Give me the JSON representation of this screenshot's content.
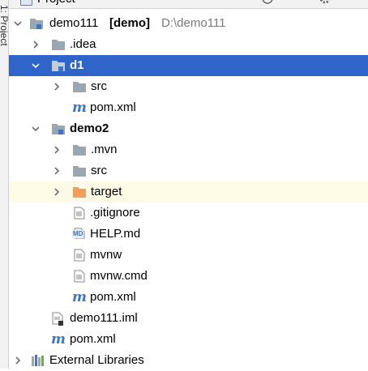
{
  "side_strip": {
    "label": "1: Project"
  },
  "header": {
    "title": "Project"
  },
  "tree": {
    "root": {
      "name": "demo111",
      "module_tag": "[demo]",
      "path": "D:\\demo111"
    },
    "idea": {
      "name": ".idea"
    },
    "d1": {
      "name": "d1",
      "children": {
        "src": "src",
        "pom": "pom.xml"
      }
    },
    "demo2": {
      "name": "demo2",
      "children": {
        "mvn": ".mvn",
        "src": "src",
        "target": "target",
        "gitignore": ".gitignore",
        "help": "HELP.md",
        "help_badge": "MD",
        "mvnw": "mvnw",
        "mvnw_cmd": "mvnw.cmd",
        "pom": "pom.xml"
      }
    },
    "iml": {
      "name": "demo111.iml"
    },
    "root_pom": {
      "name": "pom.xml"
    },
    "external": {
      "name": "External Libraries"
    }
  },
  "colors": {
    "selection": "#2f65ca",
    "highlight_row": "#fdfae6",
    "folder": "#9aa7b0",
    "excluded_folder": "#f0a05c",
    "maven_icon": "#3a77c9"
  }
}
